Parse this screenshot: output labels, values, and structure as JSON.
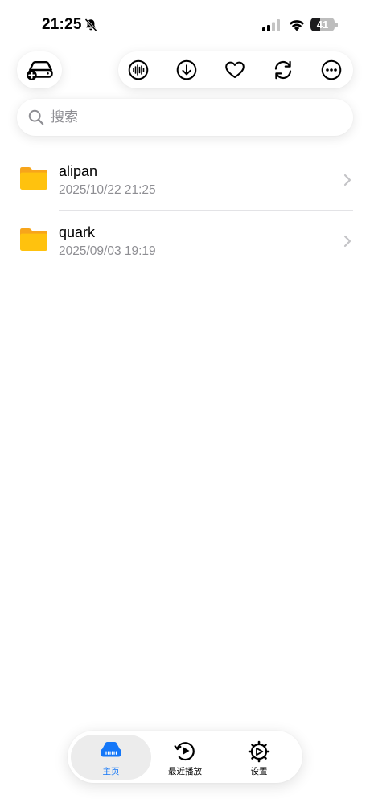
{
  "status_bar": {
    "time": "21:25",
    "battery_level": "41",
    "battery_fraction": 0.41
  },
  "toolbar": {
    "icons": [
      "add-drive-icon",
      "audio-wave-icon",
      "download-icon",
      "heart-icon",
      "sync-icon",
      "more-icon"
    ]
  },
  "search": {
    "placeholder": "搜索"
  },
  "files": [
    {
      "name": "alipan",
      "date": "2025/10/22 21:25",
      "icon": "folder-icon"
    },
    {
      "name": "quark",
      "date": "2025/09/03 19:19",
      "icon": "folder-icon"
    }
  ],
  "tab_bar": {
    "tabs": [
      {
        "label": "主页",
        "icon": "drive-icon",
        "active": true
      },
      {
        "label": "最近播放",
        "icon": "recent-play-icon",
        "active": false
      },
      {
        "label": "设置",
        "icon": "settings-icon",
        "active": false
      }
    ]
  },
  "colors": {
    "accent": "#1477f8",
    "folder": "#ffc107",
    "secondary_text": "#8e8e93"
  }
}
